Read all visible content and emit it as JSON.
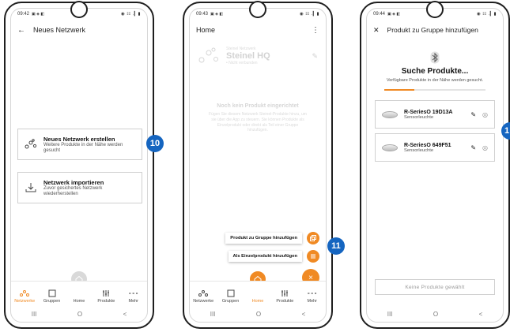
{
  "phone1": {
    "status_time": "09:42",
    "status_right": "◉ ☷ .▎▮",
    "title": "Neues Netzwerk",
    "option_new": {
      "title": "Neues Netzwerk erstellen",
      "subtitle": "Weitere Produkte in der Nähe werden gesucht"
    },
    "option_import": {
      "title": "Netzwerk importieren",
      "subtitle": "Zuvor gesichertes Netzwerk wiederherstellen"
    },
    "callout": "10",
    "nav": [
      "Netzwerke",
      "Gruppen",
      "Home",
      "Produkte",
      "Mehr"
    ]
  },
  "phone2": {
    "status_time": "09:43",
    "status_right": "◉ ☷ .▎▮",
    "title": "Home",
    "menu_icon": "⋮",
    "network_small": "Steinel Netzwerk",
    "network_name": "Steinel HQ",
    "network_status": "• Nicht verbunden",
    "empty_title": "Noch kein Produkt eingerichtet",
    "empty_body": "Fügen Sie diesem Netzwerk Steinel-Produkte hinzu, um sie über die App zu steuern. Sie können Produkte als Einzelprodukt oder direkt als Teil einer Gruppe hinzufügen.",
    "fab_group": "Produkt zu Gruppe hinzufügen",
    "fab_single": "Als Einzelprodukt hinzufügen",
    "fab_close": "×",
    "callout": "11",
    "nav": [
      "Netzwerke",
      "Gruppen",
      "Home",
      "Produkte",
      "Mehr"
    ]
  },
  "phone3": {
    "status_time": "09:44",
    "status_right": "◉ ☷ .▎▮",
    "close": "✕",
    "title": "Produkt zu Gruppe hinzufügen",
    "search_title": "Suche Produkte...",
    "search_sub": "Verfügbare Produkte in der Nähe werden gesucht.",
    "progress": 0.3,
    "products": [
      {
        "name": "R-SeriesO 19D13A",
        "type": "Sensorleuchte"
      },
      {
        "name": "R-SeriesO 649F51",
        "type": "Sensorleuchte"
      }
    ],
    "none_selected": "Keine Produkte gewählt",
    "callout": "1"
  },
  "sysnav": [
    "III",
    "O",
    "<"
  ],
  "colors": {
    "accent": "#f08a24",
    "callout": "#1565c0"
  },
  "icons": [
    "network-icon",
    "import-icon",
    "home-icon",
    "groups-icon",
    "products-icon",
    "more-icon",
    "bluetooth-icon",
    "edit-icon",
    "eye-icon"
  ]
}
